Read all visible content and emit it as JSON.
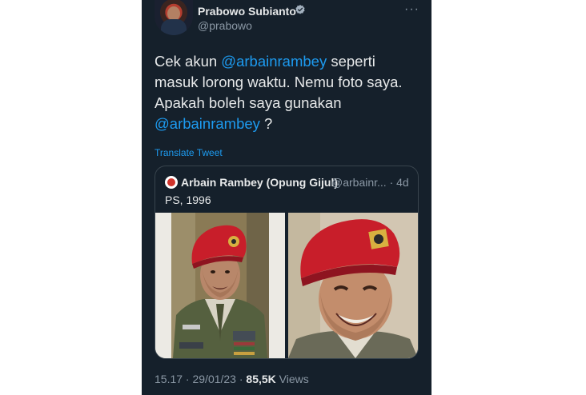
{
  "tweet": {
    "author": {
      "name": "Prabowo Subianto",
      "handle": "@prabowo",
      "verified": true,
      "avatar_icon": "profile-photo"
    },
    "text_parts": [
      "Cek akun ",
      "@arbainrambey",
      " seperti masuk lorong waktu. Nemu foto saya. Apakah boleh saya gunakan ",
      "@arbainrambey",
      " ?"
    ],
    "translate_label": "Translate Tweet",
    "more_icon": "ellipsis-icon",
    "quoted": {
      "author_name": "Arbain Rambey (Opung Gijul)",
      "handle_time": "@arbainr... · 4d",
      "text": "PS, 1996",
      "photos": [
        "portrait-in-red-beret-uniform",
        "closeup-smiling-red-beret"
      ]
    },
    "meta": {
      "time": "15.17 · 29/01/23 · ",
      "views_count": "85,5K",
      "views_label": " Views"
    },
    "colors": {
      "background": "#15202b",
      "text": "#e7e9ea",
      "secondary": "#8b98a5",
      "accent": "#1d9bf0",
      "beret": "#c81e2a"
    }
  }
}
